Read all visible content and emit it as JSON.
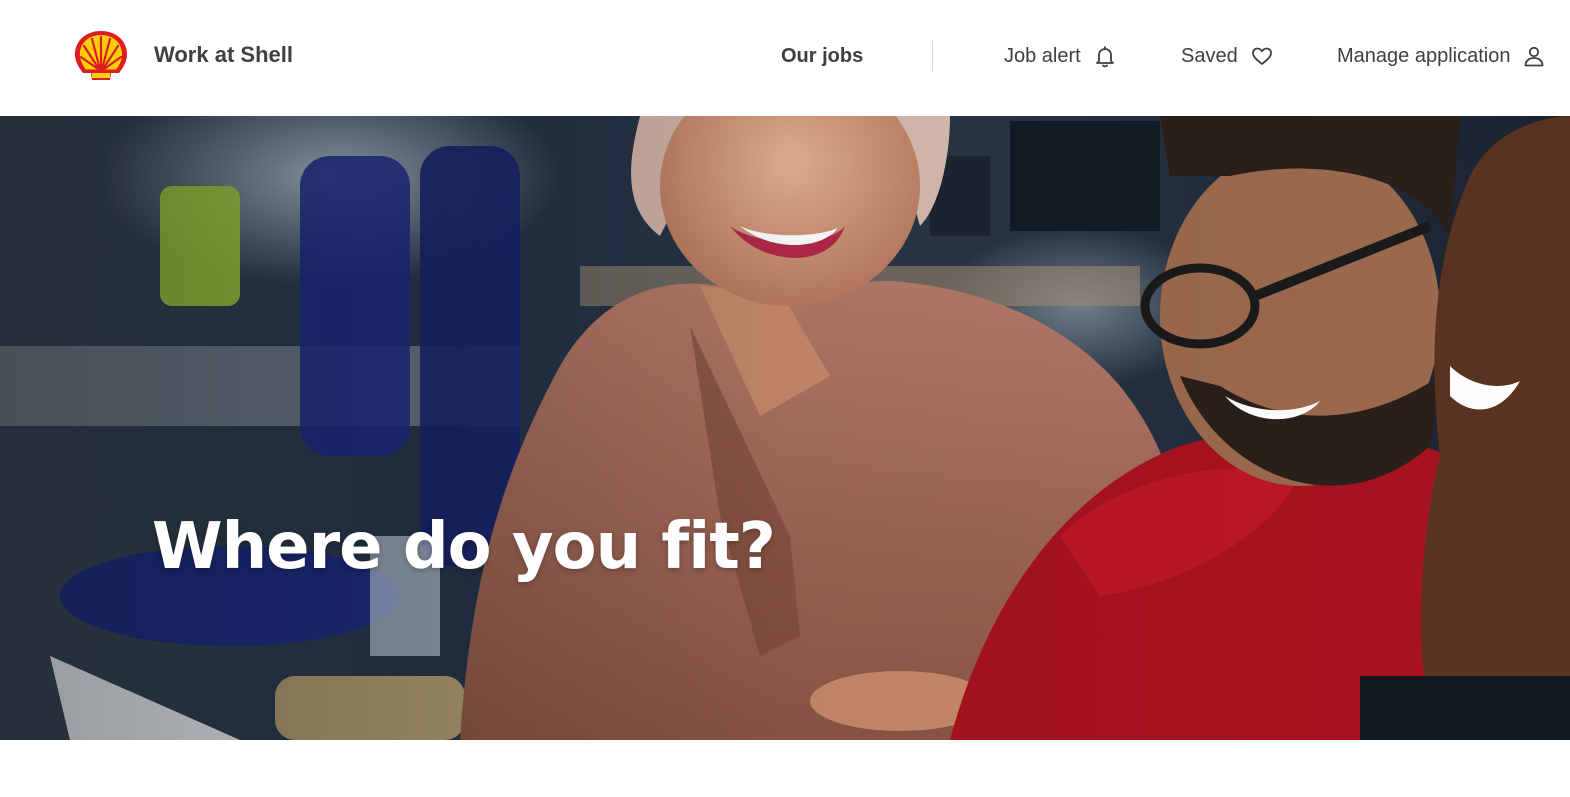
{
  "header": {
    "brand": "Work at Shell",
    "logo_icon": "shell-pecten-logo",
    "nav": {
      "our_jobs": "Our jobs",
      "job_alert": "Job alert",
      "saved": "Saved",
      "manage_application": "Manage application"
    },
    "icons": {
      "job_alert": "bell-icon",
      "saved": "heart-icon",
      "manage_application": "user-icon"
    }
  },
  "hero": {
    "title": "Where do you fit?"
  },
  "colors": {
    "shell_yellow": "#FBCE07",
    "shell_red": "#DD1D21",
    "text": "#404040"
  }
}
